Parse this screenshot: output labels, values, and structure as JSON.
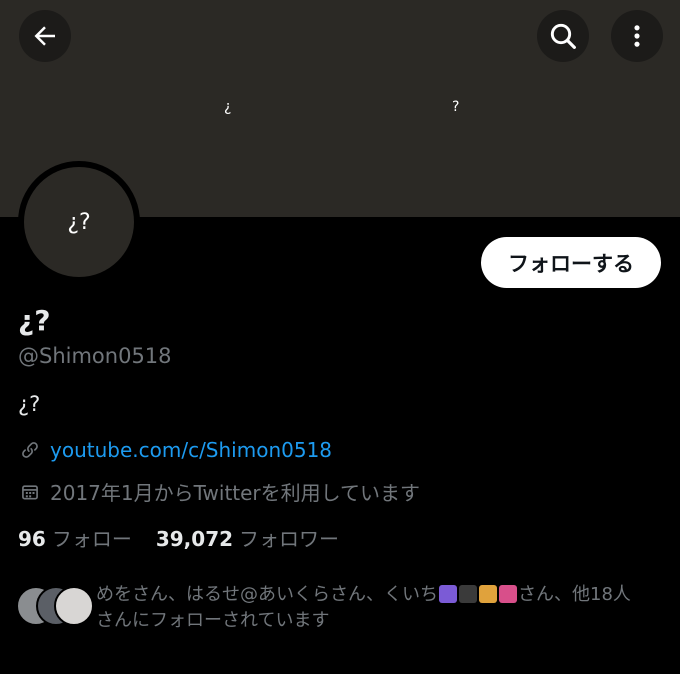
{
  "banner": {
    "text_left": "¿",
    "text_right": "?",
    "back_icon": "arrow-left-icon",
    "search_icon": "search-icon",
    "more_icon": "more-vertical-icon",
    "color": "#2b2925"
  },
  "profile": {
    "avatar_text": "¿?",
    "display_name": "¿?",
    "handle": "@Shimon0518",
    "bio": "¿?",
    "follow_button": "フォローする"
  },
  "meta": {
    "link": "youtube.com/c/Shimon0518",
    "link_icon": "link-icon",
    "joined": "2017年1月からTwitterを利用しています",
    "calendar_icon": "calendar-icon"
  },
  "stats": {
    "following_count": "96",
    "following_label": "フォロー",
    "followers_count": "39,072",
    "followers_label": "フォロワー"
  },
  "known_followers": {
    "text_part1": "めをさん、はるせ@あいくらさん、くいち",
    "text_part2": "さん、他18人",
    "text_line2": "さんにフォローされています"
  },
  "colors": {
    "link": "#1d9bf0",
    "muted": "#71767b",
    "text": "#e7e9ea"
  }
}
